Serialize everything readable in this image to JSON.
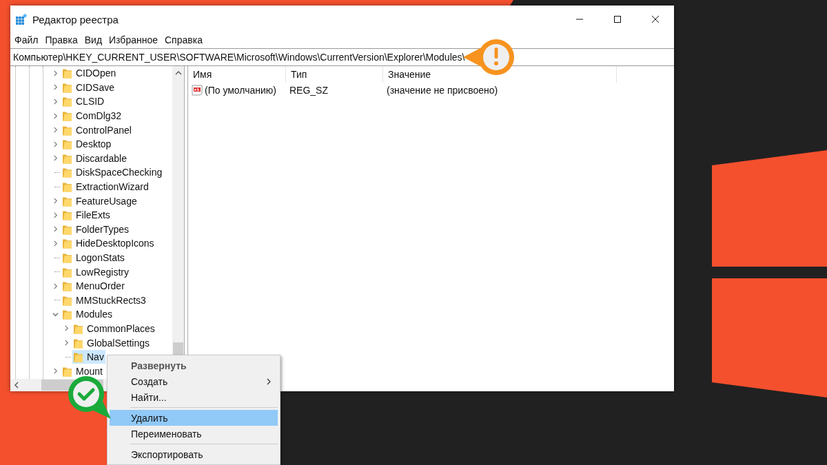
{
  "window": {
    "title": "Редактор реестра"
  },
  "menu_bar": [
    "Файл",
    "Правка",
    "Вид",
    "Избранное",
    "Справка"
  ],
  "address_bar": {
    "value": "Компьютер\\HKEY_CURRENT_USER\\SOFTWARE\\Microsoft\\Windows\\CurrentVersion\\Explorer\\Modules\\"
  },
  "tree": [
    {
      "label": "CIDOpen",
      "kind": "node",
      "expanded": false,
      "selected": false
    },
    {
      "label": "CIDSave",
      "kind": "node",
      "expanded": false,
      "selected": false
    },
    {
      "label": "CLSID",
      "kind": "node",
      "expanded": false,
      "selected": false
    },
    {
      "label": "ComDlg32",
      "kind": "node",
      "expanded": false,
      "selected": false
    },
    {
      "label": "ControlPanel",
      "kind": "node",
      "expanded": false,
      "selected": false
    },
    {
      "label": "Desktop",
      "kind": "node",
      "expanded": false,
      "selected": false
    },
    {
      "label": "Discardable",
      "kind": "node",
      "expanded": false,
      "selected": false
    },
    {
      "label": "DiskSpaceChecking",
      "kind": "leaf",
      "selected": false
    },
    {
      "label": "ExtractionWizard",
      "kind": "leaf",
      "selected": false
    },
    {
      "label": "FeatureUsage",
      "kind": "node",
      "expanded": false,
      "selected": false
    },
    {
      "label": "FileExts",
      "kind": "node",
      "expanded": false,
      "selected": false
    },
    {
      "label": "FolderTypes",
      "kind": "node",
      "expanded": false,
      "selected": false
    },
    {
      "label": "HideDesktopIcons",
      "kind": "node",
      "expanded": false,
      "selected": false
    },
    {
      "label": "LogonStats",
      "kind": "leaf",
      "selected": false
    },
    {
      "label": "LowRegistry",
      "kind": "leaf",
      "selected": false
    },
    {
      "label": "MenuOrder",
      "kind": "node",
      "expanded": false,
      "selected": false
    },
    {
      "label": "MMStuckRects3",
      "kind": "leaf",
      "selected": false
    },
    {
      "label": "Modules",
      "kind": "node",
      "expanded": true,
      "selected": false,
      "children": [
        {
          "label": "CommonPlaces",
          "kind": "node",
          "expanded": false,
          "selected": false
        },
        {
          "label": "GlobalSettings",
          "kind": "node",
          "expanded": false,
          "selected": false
        },
        {
          "label": "Nav",
          "kind": "leaf",
          "selected": true
        }
      ]
    },
    {
      "label": "Mount",
      "kind": "node",
      "expanded": false,
      "selected": false
    }
  ],
  "values_table": {
    "columns": [
      "Имя",
      "Тип",
      "Значение"
    ],
    "rows": [
      {
        "name": "(По умолчанию)",
        "type": "REG_SZ",
        "data": "(значение не присвоено)"
      }
    ]
  },
  "context_menu": [
    {
      "kind": "default",
      "label": "Развернуть",
      "selected": false
    },
    {
      "kind": "submenu",
      "label": "Создать",
      "selected": false
    },
    {
      "kind": "item",
      "label": "Найти...",
      "selected": false
    },
    {
      "kind": "separator"
    },
    {
      "kind": "item",
      "label": "Удалить",
      "selected": true
    },
    {
      "kind": "item",
      "label": "Переименовать",
      "selected": false
    },
    {
      "kind": "separator"
    },
    {
      "kind": "item",
      "label": "Экспортировать",
      "selected": false
    }
  ]
}
